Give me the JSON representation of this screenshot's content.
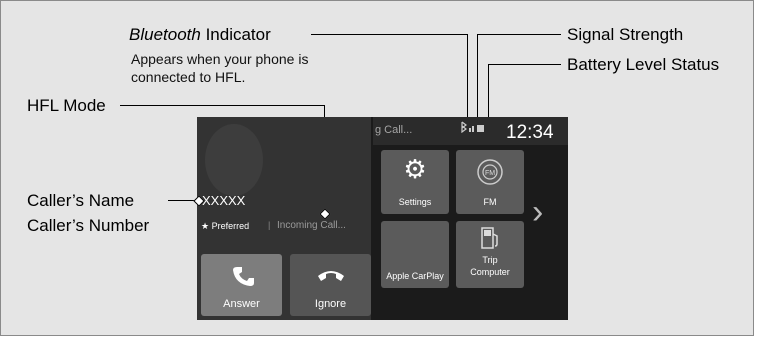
{
  "callouts": {
    "bluetooth_italic": "Bluetooth",
    "bluetooth_rest": " Indicator",
    "bluetooth_desc_line1": "Appears when your phone is",
    "bluetooth_desc_line2": "connected to HFL.",
    "signal_strength": "Signal Strength",
    "battery_level": "Battery Level Status",
    "hfl_mode": "HFL Mode",
    "callers_name": "Caller’s Name",
    "callers_number": "Caller’s Number"
  },
  "screen": {
    "header_text": "g Call...",
    "clock": "12:34",
    "caller_name": "XXXXX",
    "preferred": "★ Preferred",
    "separator": "|",
    "incoming": "Incoming Call...",
    "answer_label": "Answer",
    "ignore_label": "Ignore",
    "tiles": {
      "settings": "Settings",
      "fm": "FM",
      "carplay": "Apple CarPlay",
      "trip_line1": "Trip",
      "trip_line2": "Computer"
    },
    "fm_icon_text": "FM",
    "next_arrow": "›"
  },
  "colors": {
    "answer_bg": "#7d7d7d",
    "ignore_bg": "#555555",
    "tile_bg": "#5b5b5b"
  }
}
